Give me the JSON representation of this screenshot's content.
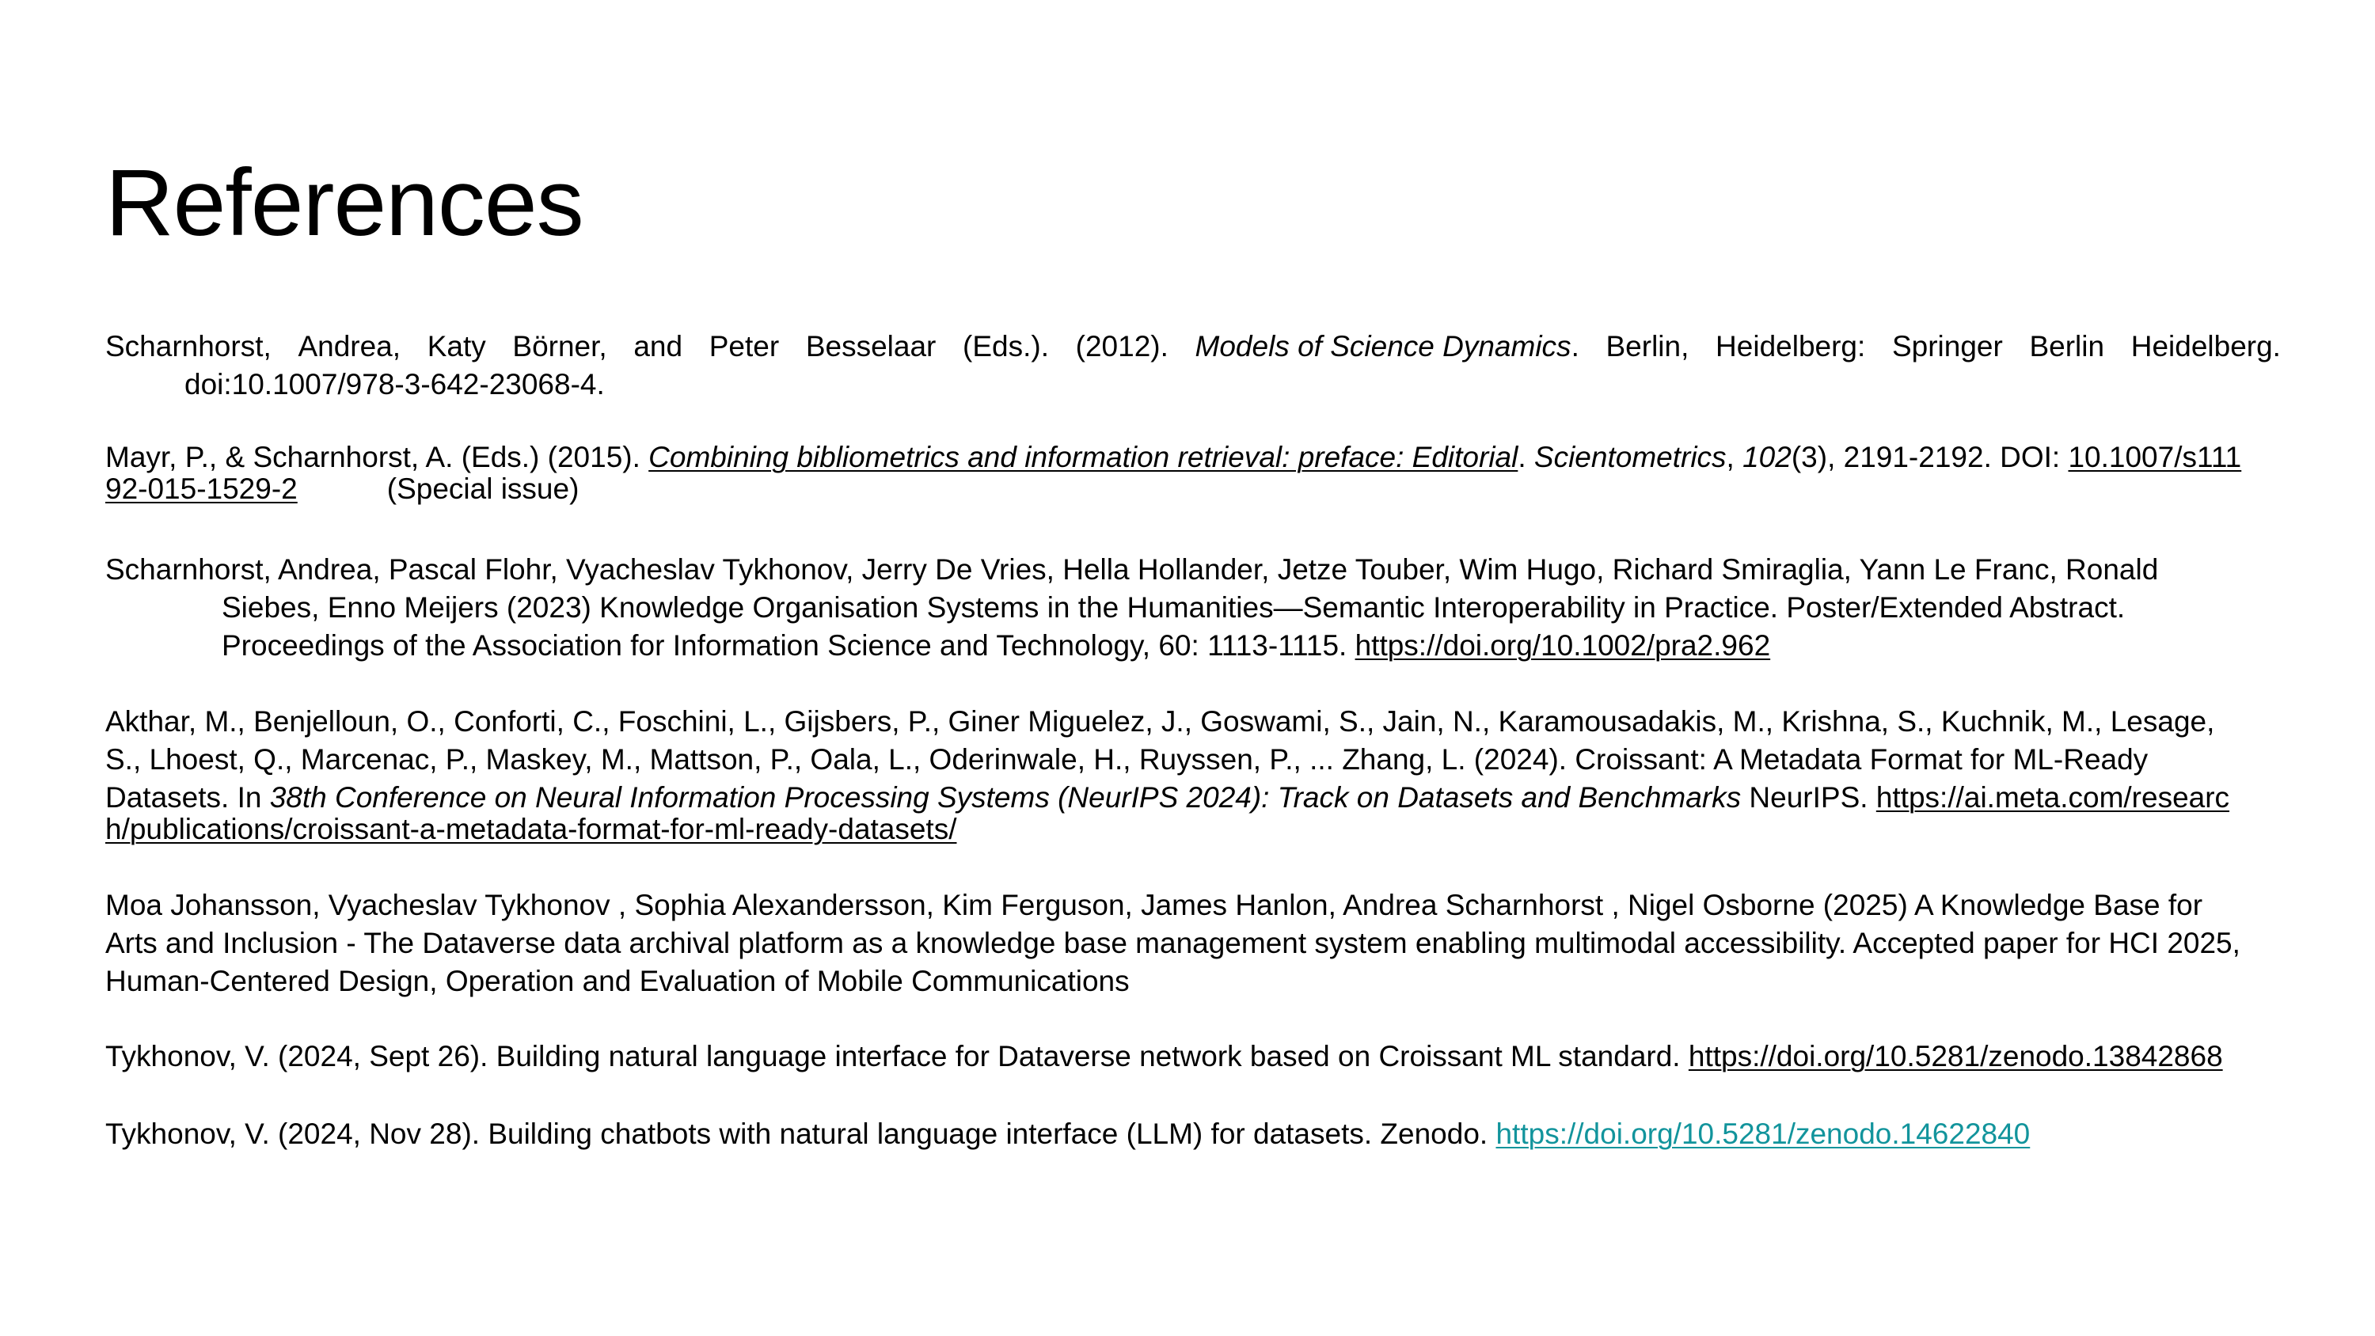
{
  "slide": {
    "title": "References"
  },
  "references": {
    "r1": {
      "words": [
        "Scharnhorst,",
        "Andrea,",
        "Katy",
        "Börner,",
        "and",
        "Peter",
        "Besselaar",
        "(Eds.).",
        "(2012)."
      ],
      "title_italic": "Models of Science Dynamics",
      "after_title_words": [
        ".",
        "Berlin,",
        "Heidelberg:",
        "Springer",
        "Berlin",
        "Heidelberg."
      ],
      "line2": "doi:10.1007/978-3-642-23068-4."
    },
    "r2": {
      "prefix": "Mayr, P., & Scharnhorst, A. (Eds.) (2015). ",
      "title_link": "Combining bibliometrics and information retrieval: preface: Editorial",
      "sep1": ". ",
      "journal": "Scientometrics",
      "sep2": ", ",
      "volume": "102",
      "pages": "(3), 2191-2192. DOI: ",
      "doi_part1": "10.1007/s111",
      "doi_part2": "92-015-1529-2",
      "note": "(Special issue)"
    },
    "r3": {
      "line1": "Scharnhorst, Andrea,  Pascal Flohr,  Vyacheslav Tykhonov,  Jerry De Vries,  Hella Hollander,  Jetze Touber,  Wim Hugo,  Richard Smiraglia,  Yann Le Franc,  Ronald",
      "line2": "Siebes,  Enno Meijers (2023) Knowledge Organisation Systems in the Humanities—Semantic Interoperability in Practice. Poster/Extended Abstract.",
      "line3": "Proceedings of the Association for Information Science and Technology, 60: 1113-1115. ",
      "doi": "https://doi.org/10.1002/pra2.962"
    },
    "r4": {
      "line1": "Akthar, M., Benjelloun, O., Conforti, C., Foschini, L., Gijsbers, P., Giner Miguelez, J., Goswami, S., Jain, N., Karamousadakis, M., Krishna, S., Kuchnik, M., Lesage,",
      "line2": "S., Lhoest, Q., Marcenac, P., Maskey, M., Mattson, P., Oala, L., Oderinwale, H., Ruyssen, P., ... Zhang, L. (2024). Croissant: A Metadata Format for ML-Ready",
      "line3_prefix": "Datasets. In ",
      "line3_italic": "38th Conference on Neural Information Processing Systems (NeurIPS 2024): Track on Datasets and Benchmarks",
      "line3_suffix": " NeurIPS. ",
      "url_part1": "https://ai.meta.com/researc",
      "url_part2": "h/publications/croissant-a-metadata-format-for-ml-ready-datasets/"
    },
    "r5": {
      "line1": "Moa Johansson, Vyacheslav Tykhonov , Sophia Alexandersson, Kim Ferguson, James Hanlon, Andrea Scharnhorst , Nigel Osborne (2025) A Knowledge Base for",
      "line2": "Arts and Inclusion - The Dataverse data archival platform as a knowledge base management system enabling multimodal accessibility. Accepted paper for HCI 2025,",
      "line3": "Human-Centered Design, Operation and Evaluation of Mobile Communications"
    },
    "r6": {
      "text": "Tykhonov, V. (2024, Sept 26). Building natural language interface for Dataverse network based on Croissant ML standard. ",
      "url": "https://doi.org/10.5281/zenodo.13842868"
    },
    "r7": {
      "text": "Tykhonov, V. (2024, Nov 28). Building chatbots with natural language interface (LLM) for datasets. Zenodo. ",
      "url": "https://doi.org/10.5281/zenodo.14622840"
    }
  },
  "colors": {
    "link_teal": "#12949c",
    "text": "#000000",
    "background": "#ffffff"
  }
}
